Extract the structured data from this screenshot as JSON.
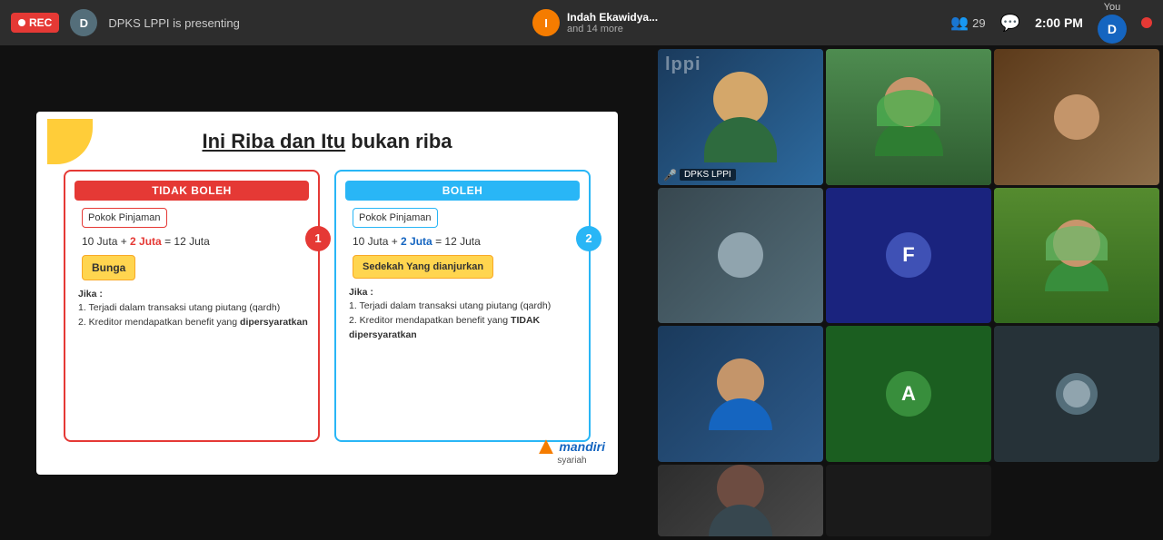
{
  "topbar": {
    "rec_label": "REC",
    "presenter_initial": "D",
    "presenter_text": "DPKS LPPI is presenting",
    "host_initial": "I",
    "host_name": "Indah Ekawidya...",
    "host_more": "and 14 more",
    "participants_count": "29",
    "time": "2:00 PM",
    "you_label": "You",
    "user_initial": "D"
  },
  "slide": {
    "title_underline": "Ini Riba dan Itu",
    "title_normal": " bukan riba",
    "col1_header": "TIDAK BOLEH",
    "col2_header": "BOLEH",
    "pokok_label": "Pokok Pinjaman",
    "formula1": "10 Juta + 2 Juta = 12 Juta",
    "formula2": "10 Juta + 2 Juta = 12 Juta",
    "bunga_label": "Bunga",
    "sedekah_label": "Sedekah Yang dianjurkan",
    "jika_label": "Jika :",
    "jika1_1": "1. Terjadi dalam transaksi utang piutang (qardh)",
    "jika1_2": "2. Kreditor mendapatkan benefit yang dipersyaratkan",
    "jika2_1": "1. Terjadi dalam transaksi utang piutang (qardh)",
    "jika2_2": "2. Kreditor mendapatkan benefit yang TIDAK dipersyaratkan",
    "badge1": "1",
    "badge2": "2",
    "logo_text": "mandiri",
    "logo_sub": "syariah"
  },
  "video_grid": {
    "cells": [
      {
        "id": "presenter",
        "label": "DPKS LPPI",
        "type": "presenter",
        "has_mic": true
      },
      {
        "id": "host",
        "label": "",
        "type": "host",
        "has_mic": false
      },
      {
        "id": "p3",
        "label": "",
        "type": "p3",
        "has_mic": false
      },
      {
        "id": "p4",
        "label": "",
        "type": "p4",
        "has_mic": false
      },
      {
        "id": "p5",
        "label": "",
        "type": "p5",
        "initial": "F",
        "has_mic": false
      },
      {
        "id": "p6",
        "label": "",
        "type": "p6",
        "has_mic": false
      },
      {
        "id": "p7",
        "label": "",
        "type": "p7",
        "has_mic": false
      },
      {
        "id": "p8",
        "label": "",
        "type": "p8",
        "initial": "A",
        "has_mic": false
      },
      {
        "id": "p9",
        "label": "",
        "type": "p9",
        "has_mic": false
      },
      {
        "id": "p10",
        "label": "",
        "type": "p10",
        "has_mic": false
      },
      {
        "id": "p11",
        "label": "",
        "type": "p11",
        "has_mic": false
      }
    ]
  }
}
